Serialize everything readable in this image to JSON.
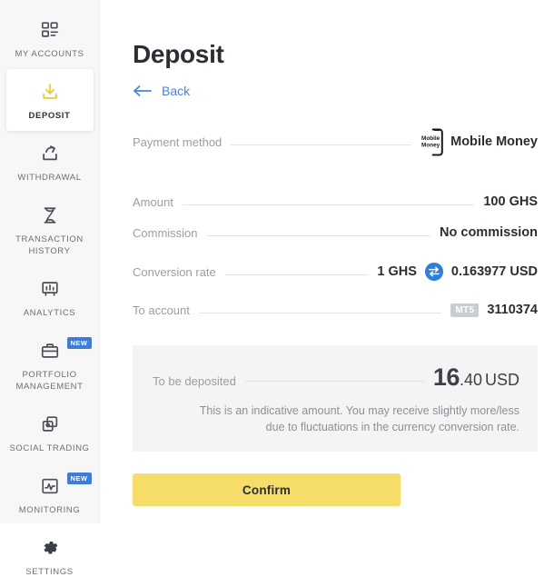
{
  "sidebar": {
    "items": [
      {
        "label": "MY ACCOUNTS",
        "icon": "grid-list-icon",
        "active": false,
        "badge": null
      },
      {
        "label": "DEPOSIT",
        "icon": "download-icon",
        "active": true,
        "badge": null
      },
      {
        "label": "WITHDRAWAL",
        "icon": "upload-share-icon",
        "active": false,
        "badge": null
      },
      {
        "label": "TRANSACTION HISTORY",
        "icon": "hourglass-icon",
        "active": false,
        "badge": null
      },
      {
        "label": "ANALYTICS",
        "icon": "chart-board-icon",
        "active": false,
        "badge": null
      },
      {
        "label": "PORTFOLIO MANAGEMENT",
        "icon": "briefcase-icon",
        "active": false,
        "badge": "NEW"
      },
      {
        "label": "SOCIAL TRADING",
        "icon": "copy-cards-icon",
        "active": false,
        "badge": null
      },
      {
        "label": "MONITORING",
        "icon": "pulse-monitor-icon",
        "active": false,
        "badge": "NEW"
      },
      {
        "label": "SETTINGS",
        "icon": "gear-icon",
        "active": false,
        "badge": null
      }
    ]
  },
  "main": {
    "title": "Deposit",
    "back_label": "Back",
    "rows": {
      "payment_method": {
        "label": "Payment method",
        "value": "Mobile Money",
        "logo": "mobile-money-logo"
      },
      "amount": {
        "label": "Amount",
        "value": "100 GHS"
      },
      "commission": {
        "label": "Commission",
        "value": "No commission"
      },
      "conversion_rate": {
        "label": "Conversion rate",
        "from": "1 GHS",
        "to": "0.163977 USD",
        "icon": "swap-exchange-icon"
      },
      "to_account": {
        "label": "To account",
        "badge": "MT5",
        "value": "3110374"
      }
    },
    "summary": {
      "label": "To be deposited",
      "amount_integer": "16",
      "amount_decimal": ".40",
      "currency": "USD",
      "note": "This is an indicative amount. You may receive slightly more/less due to fluctuations in the currency conversion rate."
    },
    "confirm_label": "Confirm"
  },
  "colors": {
    "accent_yellow": "#f6dd6a",
    "link_blue": "#4b82e0",
    "badge_blue": "#3b7dd8",
    "badge_gray": "#c9ccd1",
    "sidebar_bg": "#f7f7f8",
    "summary_bg": "#f4f4f5"
  }
}
